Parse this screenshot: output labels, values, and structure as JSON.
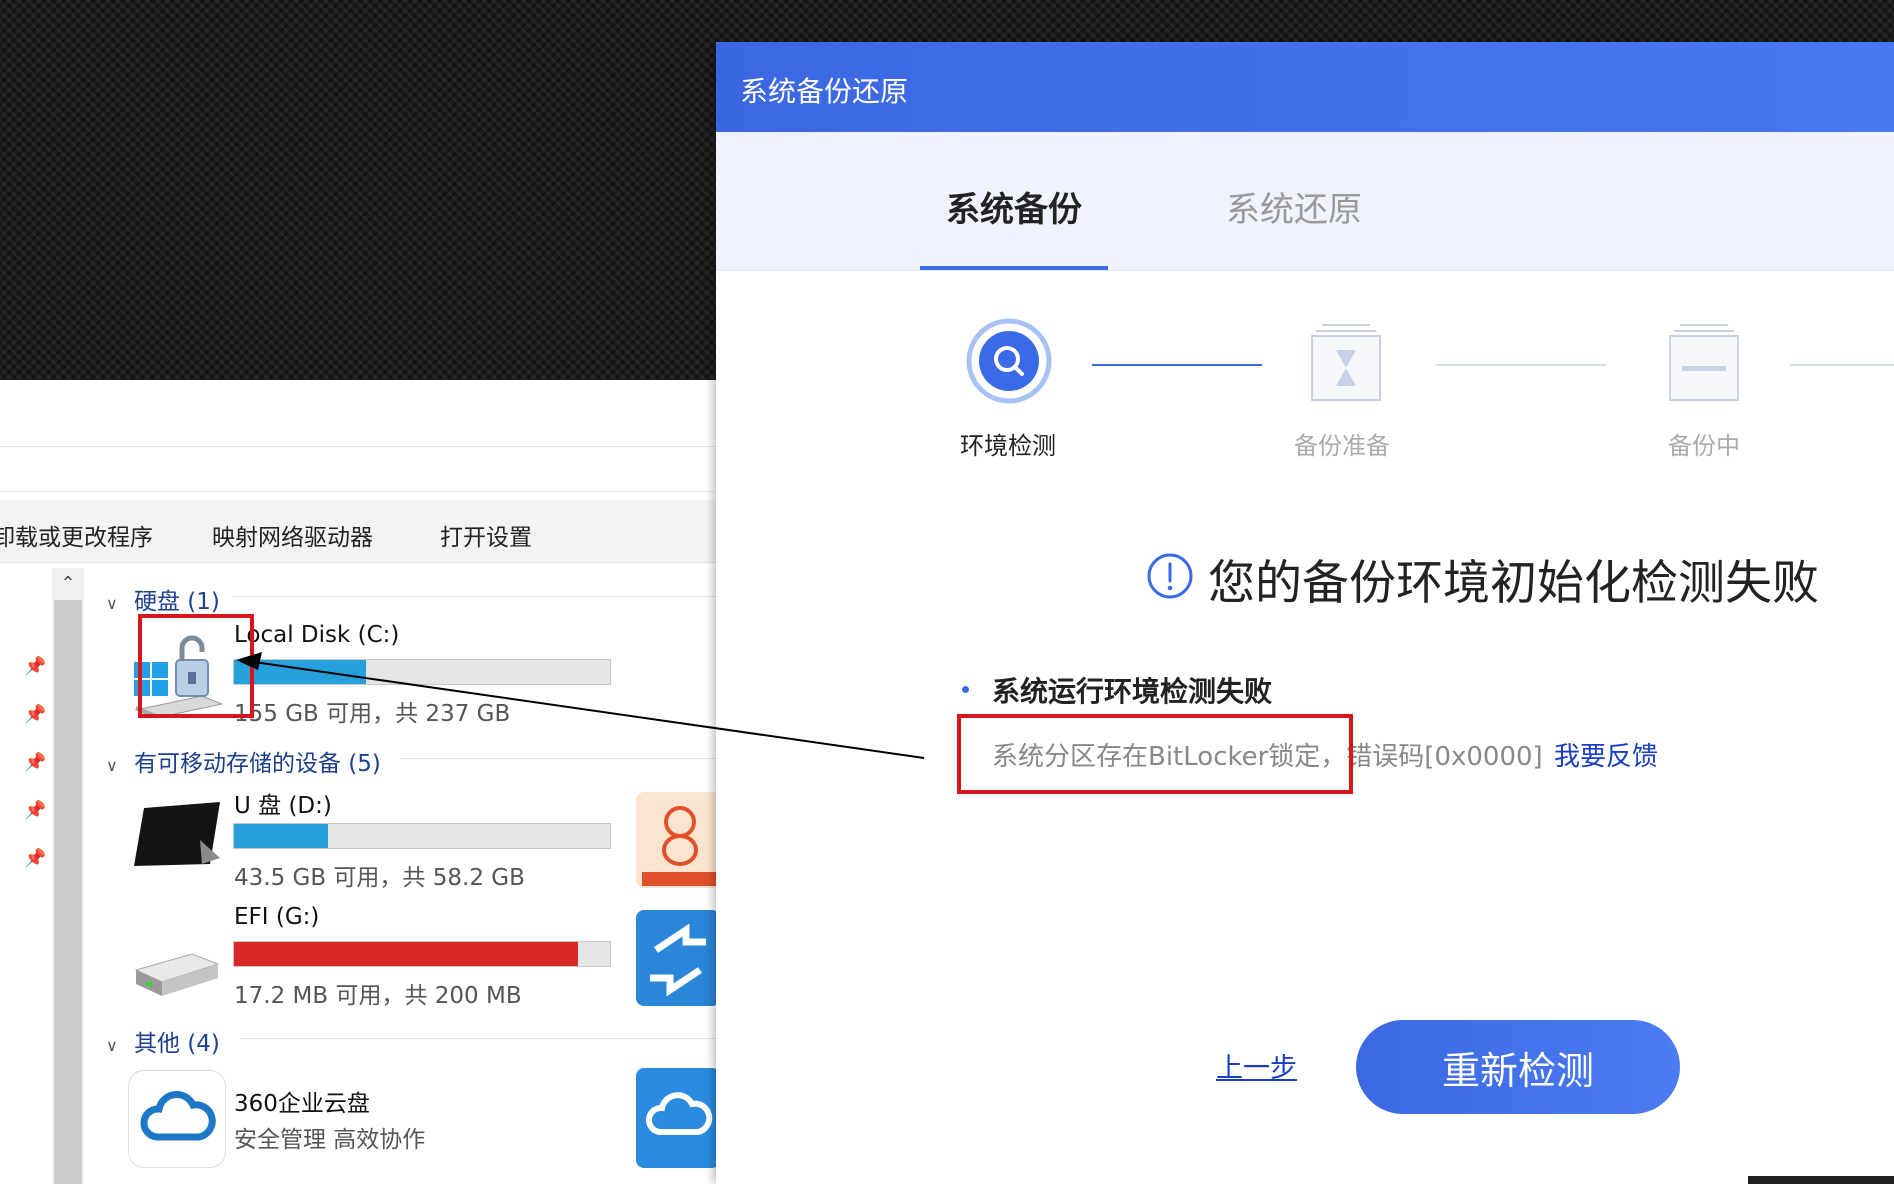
{
  "dialog": {
    "title": "系统备份还原",
    "tabs": [
      {
        "label": "系统备份",
        "active": true
      },
      {
        "label": "系统还原",
        "active": false
      }
    ],
    "steps": [
      {
        "label": "环境检测",
        "state": "active",
        "icon": "search-icon"
      },
      {
        "label": "备份准备",
        "state": "pending",
        "icon": "hourglass-icon"
      },
      {
        "label": "备份中",
        "state": "pending",
        "icon": "progress-icon"
      }
    ],
    "message_title": "您的备份环境初始化检测失败",
    "detail_title": "系统运行环境检测失败",
    "detail_text": "系统分区存在BitLocker锁定，错误码[0x0000]",
    "feedback_link": "我要反馈",
    "prev_button": "上一步",
    "retry_button": "重新检测"
  },
  "explorer": {
    "toolbar": [
      "卸载或更改程序",
      "映射网络驱动器",
      "打开设置"
    ],
    "groups": {
      "hdd": "硬盘 (1)",
      "removable": "有可移动存储的设备 (5)",
      "other": "其他 (4)"
    },
    "drives": [
      {
        "name": "Local Disk (C:)",
        "info": "155 GB 可用，共 237 GB",
        "used_fraction": 0.35,
        "locked": true
      },
      {
        "name": "U 盘 (D:)",
        "info": "43.5 GB 可用，共 58.2 GB",
        "used_fraction": 0.25
      },
      {
        "name": "EFI (G:)",
        "info": "17.2 MB 可用，共 200 MB",
        "used_fraction": 0.914
      }
    ],
    "cloud_app": {
      "name": "360企业云盘",
      "desc": "安全管理 高效协作"
    }
  },
  "colors": {
    "accent": "#3b6ae6",
    "highlight_red": "#d8141c",
    "drive_fill": "#26a0da",
    "drive_full": "#da2626"
  }
}
